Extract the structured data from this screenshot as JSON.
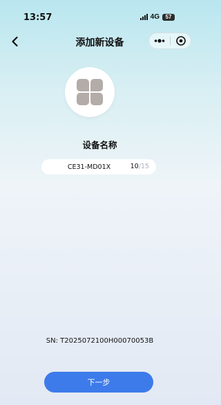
{
  "status_bar": {
    "time": "13:57",
    "network": "4G",
    "battery": "57"
  },
  "nav": {
    "title": "添加新设备",
    "back_icon": "chevron-left-icon",
    "more_icon": "more-dots-icon",
    "close_icon": "target-circle-icon"
  },
  "device": {
    "image_icon": "four-petal-device-icon",
    "name_label": "设备名称",
    "name_value": "CE31-MD01X",
    "name_count": "10",
    "name_max": "/15"
  },
  "sn_text": "SN: T2025072100H00070053B",
  "next_button": "下一步",
  "colors": {
    "accent": "#3d7bea",
    "background_top": "#b9e6ef",
    "background_bottom": "#e3e9f4",
    "icon_gray": "#b3aca8"
  }
}
